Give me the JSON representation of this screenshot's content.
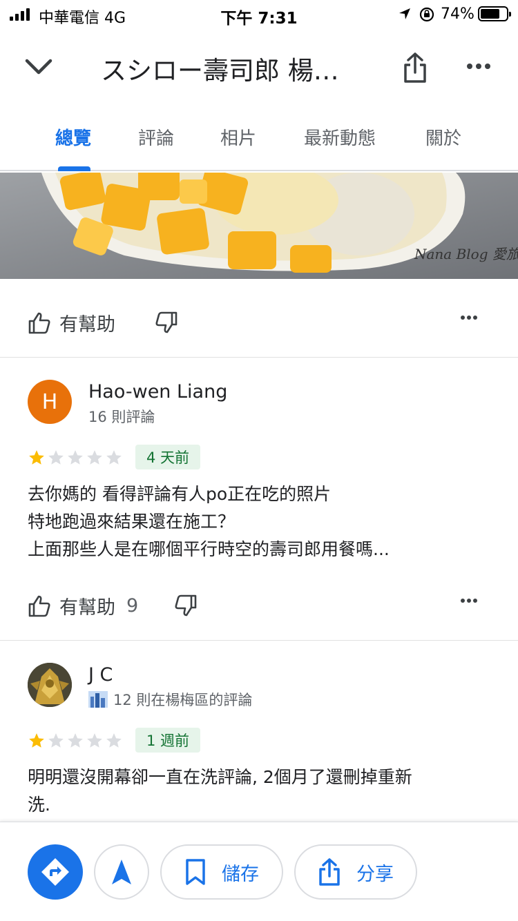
{
  "status_bar": {
    "carrier": "中華電信  4G",
    "time": "下午 7:31",
    "battery": "74%",
    "battery_level": 0.74
  },
  "header": {
    "title": "スシロー壽司郎 楊…",
    "back_icon": "chevron-down-icon",
    "share_icon": "share-icon",
    "more_icon": "more-horizontal-icon"
  },
  "tabs": [
    {
      "label": "總覽",
      "active": true
    },
    {
      "label": "評論",
      "active": false
    },
    {
      "label": "相片",
      "active": false
    },
    {
      "label": "最新動態",
      "active": false
    },
    {
      "label": "關於",
      "active": false
    }
  ],
  "photo": {
    "watermark": "Nana Blog 愛旅行"
  },
  "first_actions": {
    "helpful_label": "有幫助"
  },
  "reviews": [
    {
      "avatar_letter": "H",
      "avatar_color": "#e8710a",
      "author": "Hao-wen Liang",
      "meta": "16 則評論",
      "rating": 1,
      "max_rating": 5,
      "date": "4 天前",
      "text_lines": [
        "去你媽的 看得評論有人po正在吃的照片",
        "特地跑過來結果還在施工？",
        "上面那些人是在哪個平行時空的壽司郎用餐嗎..."
      ],
      "helpful_label": "有幫助",
      "helpful_count": "9"
    },
    {
      "author": "J C",
      "meta": "12 則在楊梅區的評論",
      "rating": 1,
      "max_rating": 5,
      "date": "1 週前",
      "text_lines": [
        "明明還沒開幕卻一直在洗評論, 2個月了還刪掉重新",
        "洗."
      ]
    }
  ],
  "bottom_bar": {
    "save_label": "儲存",
    "share_label": "分享"
  },
  "colors": {
    "accent": "#1a73e8",
    "star": "#fbbc04",
    "star_empty": "#dadce0",
    "badge_bg": "#e6f4ea",
    "badge_text": "#137333"
  }
}
